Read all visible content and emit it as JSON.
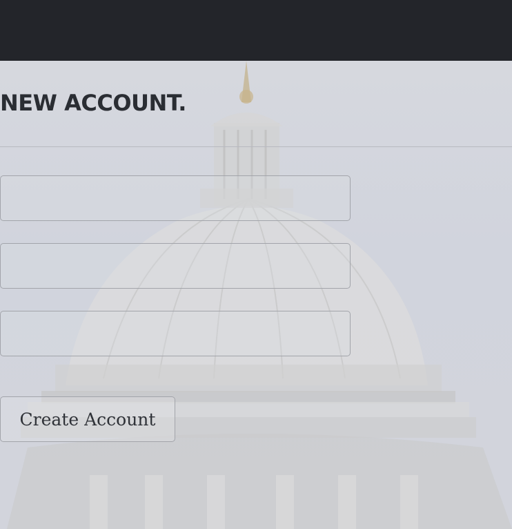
{
  "header": {},
  "form": {
    "title": "NEW ACCOUNT.",
    "fields": [
      {
        "value": "",
        "placeholder": ""
      },
      {
        "value": "",
        "placeholder": ""
      },
      {
        "value": "",
        "placeholder": ""
      }
    ],
    "submit_label": "Create Account"
  },
  "colors": {
    "header_bg": "#23252a",
    "page_bg": "#d3d6df",
    "title_text": "#2a2d33",
    "field_border": "#a2a4aa"
  },
  "background": {
    "subject": "capitol-dome-photo"
  }
}
